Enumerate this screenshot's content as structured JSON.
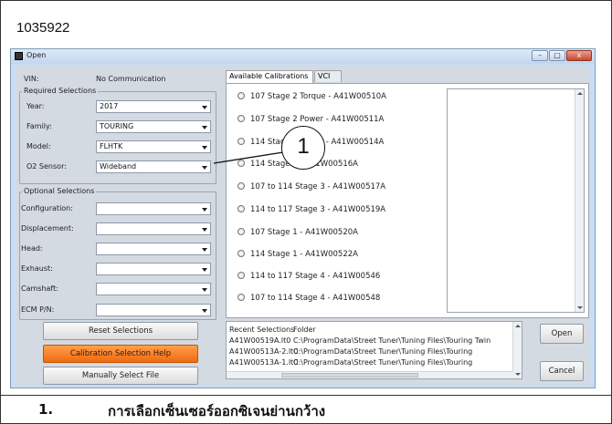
{
  "figure_id": "1035922",
  "window": {
    "title": "Open",
    "controls": {
      "minimize": "–",
      "maximize": "□",
      "close": "x"
    }
  },
  "status": {
    "vin_label": "VIN:",
    "vin_value": "No Communication"
  },
  "required": {
    "title": "Required Selections",
    "fields": [
      {
        "label": "Year:",
        "value": "2017"
      },
      {
        "label": "Family:",
        "value": "TOURING"
      },
      {
        "label": "Model:",
        "value": "FLHTK"
      },
      {
        "label": "O2 Sensor:",
        "value": "Wideband"
      }
    ]
  },
  "optional": {
    "title": "Optional Selections",
    "fields": [
      {
        "label": "Configuration:",
        "value": ""
      },
      {
        "label": "Displacement:",
        "value": ""
      },
      {
        "label": "Head:",
        "value": ""
      },
      {
        "label": "Exhaust:",
        "value": ""
      },
      {
        "label": "Camshaft:",
        "value": ""
      },
      {
        "label": "ECM P/N:",
        "value": ""
      }
    ]
  },
  "buttons": {
    "reset": "Reset Selections",
    "help": "Calibration Selection Help",
    "manual": "Manually Select File",
    "open": "Open",
    "cancel": "Cancel"
  },
  "tabs": [
    "Available Calibrations",
    "VCI"
  ],
  "calibrations": [
    "107 Stage 2 Torque - A41W00510A",
    "107 Stage 2 Power - A41W00511A",
    "114 Stage 2 Power - A41W00514A",
    "114 Stage 2 - A41W00516A",
    "107 to 114 Stage 3 - A41W00517A",
    "114 to 117 Stage 3 - A41W00519A",
    "107 Stage 1 - A41W00520A",
    "114 Stage 1 - A41W00522A",
    "114 to 117 Stage 4 - A41W00546",
    "107 to 114 Stage 4 - A41W00548"
  ],
  "recent": {
    "headers": [
      "Recent Selections",
      "Folder"
    ],
    "rows": [
      [
        "A41W00519A.lt0",
        "C:\\ProgramData\\Street Tuner\\Tuning Files\\Touring Twin"
      ],
      [
        "A41W00513A-2.lt0",
        "C:\\ProgramData\\Street Tuner\\Tuning Files\\Touring"
      ],
      [
        "A41W00513A-1.lt0",
        "C:\\ProgramData\\Street Tuner\\Tuning Files\\Touring"
      ]
    ]
  },
  "callout": "1",
  "caption": {
    "number": "1.",
    "text": "การเลือกเซ็นเซอร์ออกซิเจนย่านกว้าง"
  }
}
